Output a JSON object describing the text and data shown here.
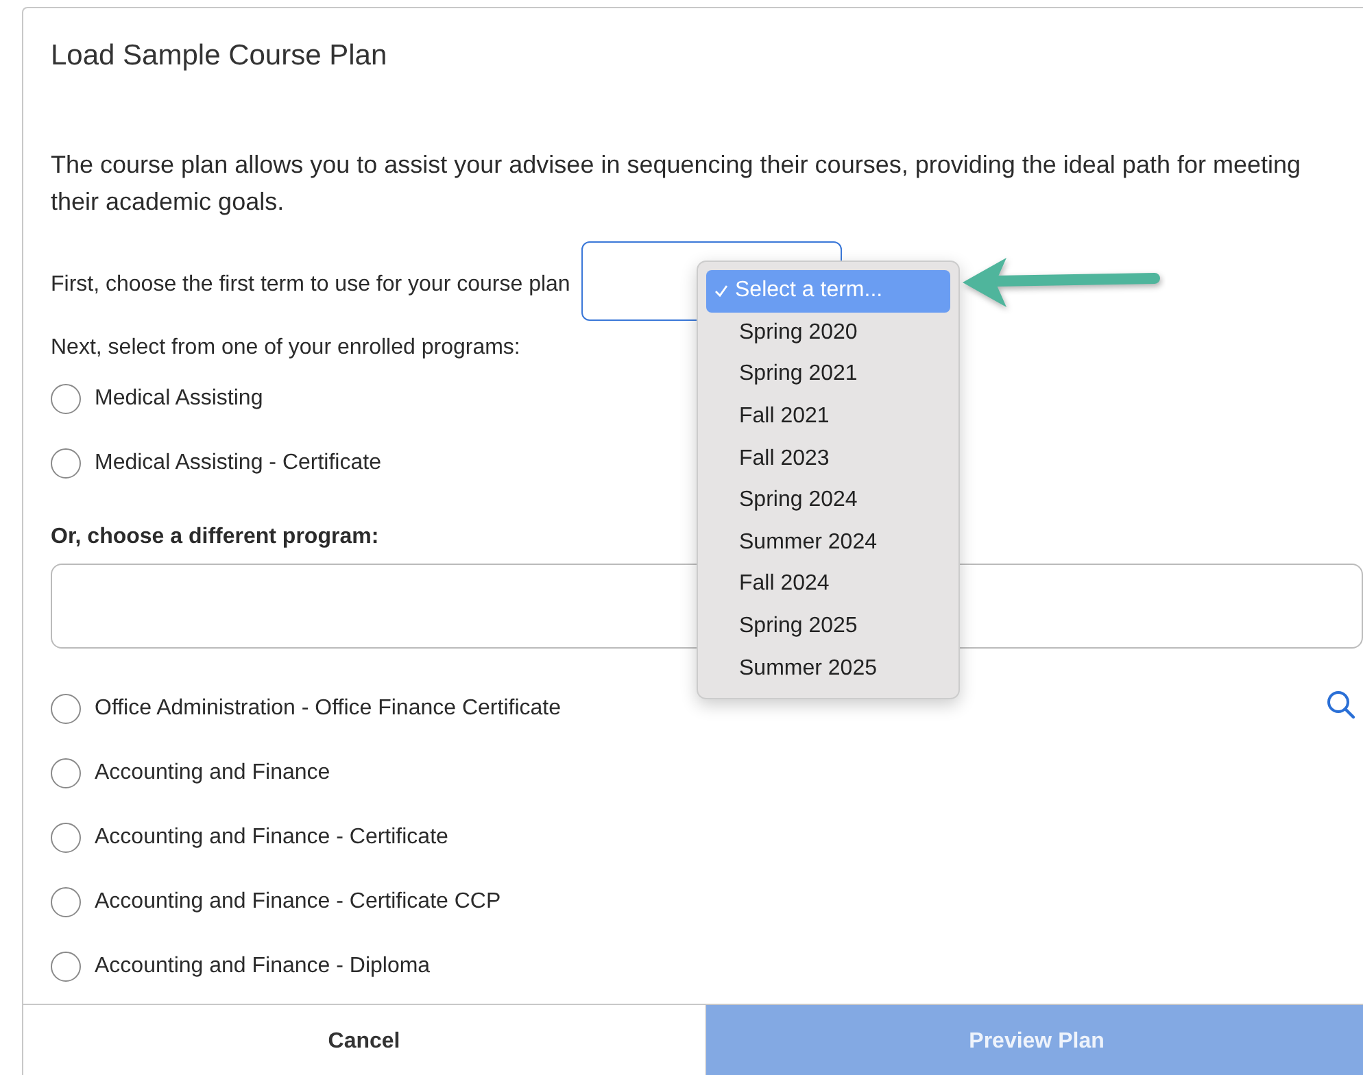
{
  "dialog": {
    "title": "Load Sample Course Plan"
  },
  "intro": "The course plan allows you to assist your advisee in sequencing their courses, providing the ideal path for meeting their academic goals.",
  "term_prompt": "First, choose the first term to use for your course plan",
  "term_menu": {
    "options": [
      {
        "label": "Select a term...",
        "selected": true
      },
      {
        "label": "Spring 2020",
        "selected": false
      },
      {
        "label": "Spring 2021",
        "selected": false
      },
      {
        "label": "Fall 2021",
        "selected": false
      },
      {
        "label": "Fall 2023",
        "selected": false
      },
      {
        "label": "Spring 2024",
        "selected": false
      },
      {
        "label": "Summer 2024",
        "selected": false
      },
      {
        "label": "Fall 2024",
        "selected": false
      },
      {
        "label": "Spring 2025",
        "selected": false
      },
      {
        "label": "Summer 2025",
        "selected": false
      }
    ]
  },
  "enrolled_prompt": "Next, select from one of your enrolled programs:",
  "enrolled_programs": [
    {
      "label": "Medical Assisting",
      "selected": false
    },
    {
      "label": "Medical Assisting - Certificate",
      "selected": false
    }
  ],
  "other_prompt": "Or, choose a different program:",
  "other_programs": [
    {
      "label": "Office Administration - Office Finance Certificate",
      "selected": false
    },
    {
      "label": "Accounting and Finance",
      "selected": false
    },
    {
      "label": "Accounting and Finance - Certificate",
      "selected": false
    },
    {
      "label": "Accounting and Finance - Certificate CCP",
      "selected": false
    },
    {
      "label": "Accounting and Finance - Diploma",
      "selected": false
    }
  ],
  "buttons": [
    {
      "label": "Cancel",
      "kind": "secondary"
    },
    {
      "label": "Preview Plan",
      "kind": "primary",
      "disabled": true
    }
  ]
}
